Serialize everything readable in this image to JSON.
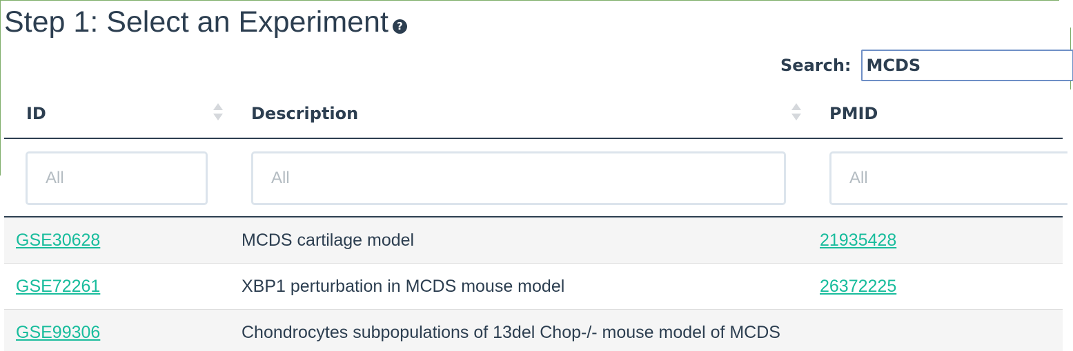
{
  "page": {
    "title": "Step 1: Select an Experiment",
    "help_icon": "question-circle-icon"
  },
  "search": {
    "label": "Search:",
    "value": "MCDS"
  },
  "table": {
    "columns": [
      "ID",
      "Description",
      "PMID"
    ],
    "filter_placeholders": [
      "All",
      "All",
      "All"
    ],
    "rows": [
      {
        "id": "GSE30628",
        "description": "MCDS cartilage model",
        "pmid": "21935428"
      },
      {
        "id": "GSE72261",
        "description": "XBP1 perturbation in MCDS mouse model",
        "pmid": "26372225"
      },
      {
        "id": "GSE99306",
        "description": "Chondrocytes subpopulations of 13del Chop-/- mouse model of MCDS",
        "pmid": ""
      }
    ]
  },
  "colors": {
    "text": "#2c3e50",
    "link": "#18bc9c",
    "search_border": "#6e8fc6",
    "filter_border": "#dce4ec",
    "striped_row": "#f5f5f5"
  }
}
